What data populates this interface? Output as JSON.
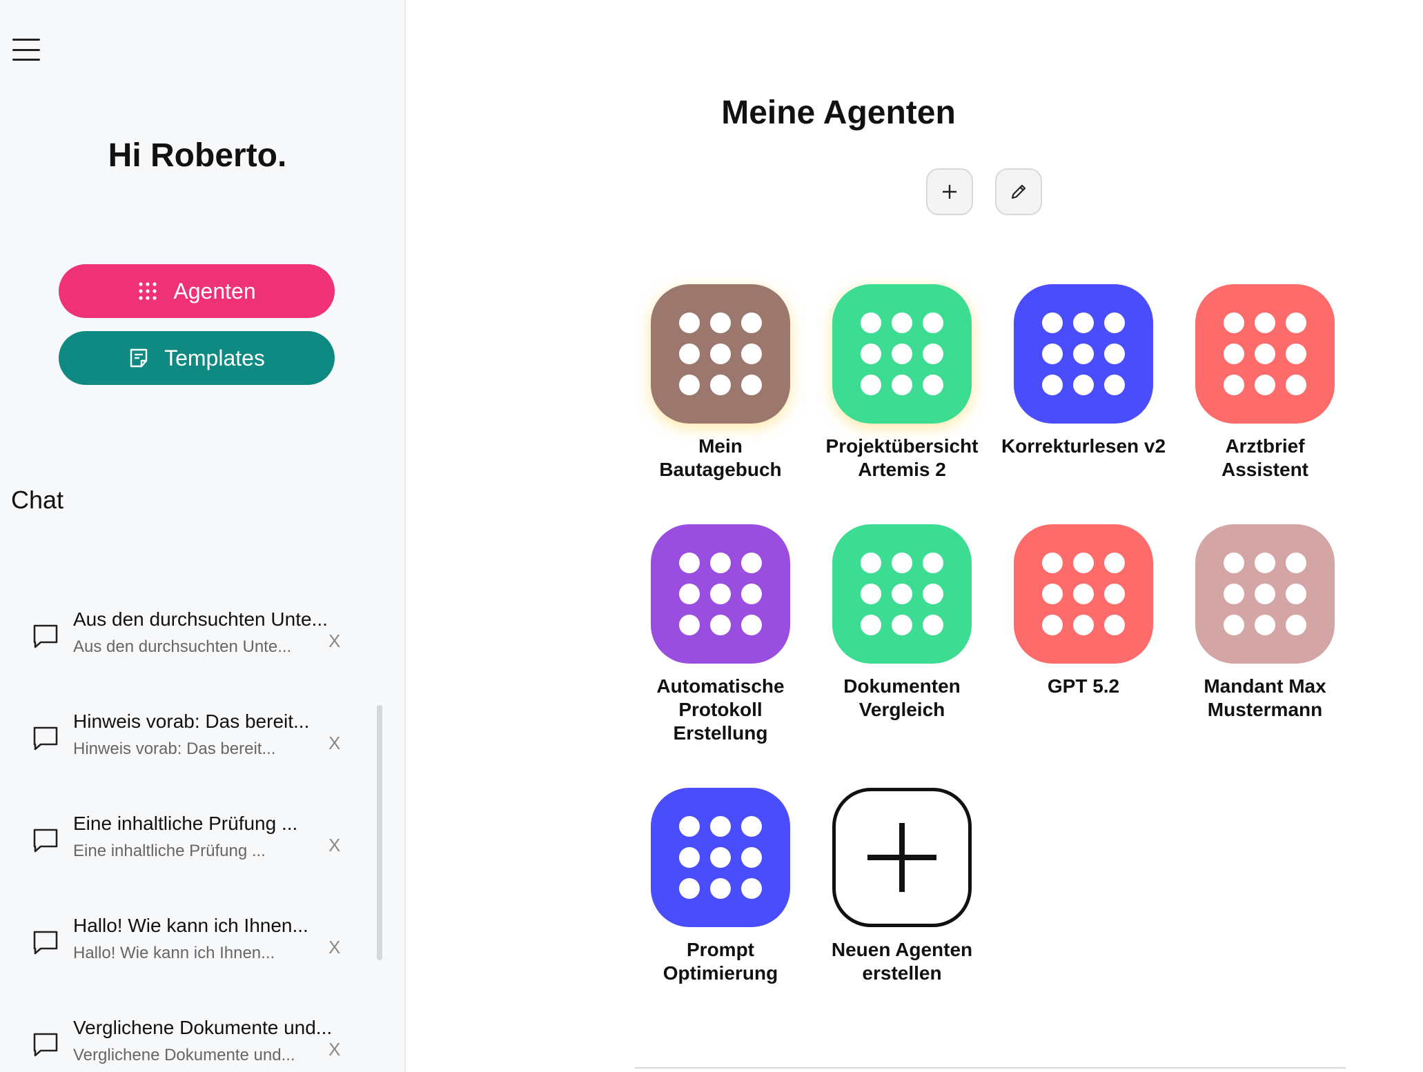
{
  "sidebar": {
    "greeting": "Hi Roberto.",
    "nav": {
      "agents_label": "Agenten",
      "templates_label": "Templates"
    },
    "chat_section_title": "Chat",
    "chats": [
      {
        "title": "Aus den durchsuchten Unte...",
        "preview": "Aus den durchsuchten Unte...",
        "close": "X"
      },
      {
        "title": "Hinweis vorab: Das bereit...",
        "preview": "Hinweis vorab: Das bereit...",
        "close": "X"
      },
      {
        "title": "Eine inhaltliche Prüfung ...",
        "preview": "Eine inhaltliche Prüfung ...",
        "close": "X"
      },
      {
        "title": "Hallo! Wie kann ich Ihnen...",
        "preview": "Hallo! Wie kann ich Ihnen...",
        "close": "X"
      },
      {
        "title": "Verglichene Dokumente und...",
        "preview": "Verglichene Dokumente und...",
        "close": "X"
      }
    ]
  },
  "main": {
    "title": "Meine Agenten",
    "agents": [
      {
        "label": "Mein\nBautagebuch",
        "color": "#9b776d",
        "icon": "grid-dots-icon"
      },
      {
        "label": "Projektübersicht\nArtemis 2",
        "color": "#3ddc93",
        "icon": "grid-dots-icon"
      },
      {
        "label": "Korrekturlesen v2",
        "color": "#4a4dfb",
        "icon": "grid-dots-icon"
      },
      {
        "label": "Arztbrief\nAssistent",
        "color": "#fd6b6b",
        "icon": "grid-dots-icon"
      },
      {
        "label": "Automatische\nProtokoll\nErstellung",
        "color": "#9a4ee0",
        "icon": "grid-dots-icon"
      },
      {
        "label": "Dokumenten\nVergleich",
        "color": "#3ddc93",
        "icon": "grid-dots-icon"
      },
      {
        "label": "GPT 5.2",
        "color": "#fd6b6b",
        "icon": "grid-dots-icon"
      },
      {
        "label": "Mandant Max\nMustermann",
        "color": "#d4a5a5",
        "icon": "grid-dots-icon"
      },
      {
        "label": "Prompt\nOptimierung",
        "color": "#4a4dfb",
        "icon": "grid-dots-icon"
      }
    ],
    "new_agent_label": "Neuen Agenten\nerstellen"
  },
  "colors": {
    "agents_button": "#ef3275",
    "templates_button": "#0f8a82",
    "sidebar_bg": "#f7f8fa"
  }
}
